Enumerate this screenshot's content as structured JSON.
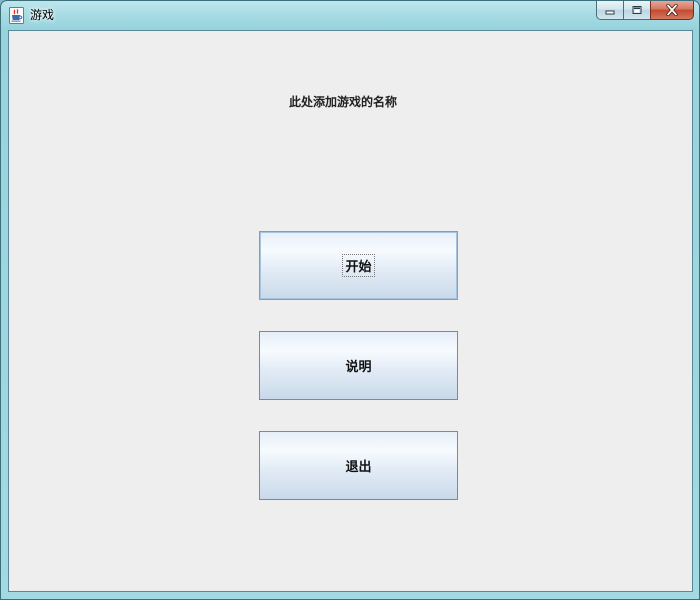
{
  "window": {
    "title": "游戏",
    "icon": "java-coffee-cup-icon",
    "caption_buttons": [
      "minimize-icon",
      "maximize-icon",
      "close-icon"
    ]
  },
  "main": {
    "game_title": "此处添加游戏的名称",
    "buttons": {
      "start": "开始",
      "help": "说明",
      "exit": "退出"
    },
    "focused_button": "start"
  }
}
